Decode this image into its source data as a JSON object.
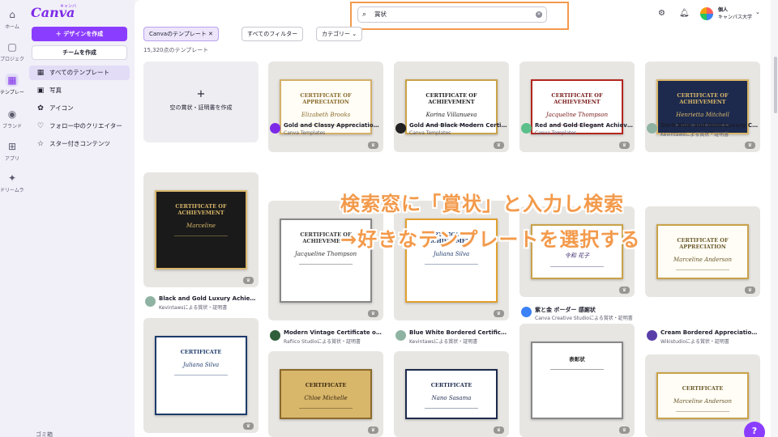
{
  "rail": [
    {
      "icon": "⌂",
      "label": "ホーム",
      "name": "home"
    },
    {
      "icon": "▢",
      "label": "プロジェクト",
      "name": "projects"
    },
    {
      "icon": "▦",
      "label": "テンプレート",
      "name": "templates",
      "active": true
    },
    {
      "icon": "◉",
      "label": "ブランド",
      "name": "brand"
    },
    {
      "icon": "⊞",
      "label": "アプリ",
      "name": "apps"
    },
    {
      "icon": "✦",
      "label": "ドリームラボ",
      "name": "dreamlab"
    }
  ],
  "sidebar": {
    "logo": "Canva",
    "logo_kana": "キャンバ",
    "create_label": "＋ デザインを作成",
    "team_label": "チームを作成",
    "items": [
      {
        "icon": "▦",
        "label": "すべてのテンプレート",
        "active": true
      },
      {
        "icon": "▣",
        "label": "写真"
      },
      {
        "icon": "✿",
        "label": "アイコン"
      },
      {
        "icon": "♡",
        "label": "フォロー中のクリエイター"
      },
      {
        "icon": "☆",
        "label": "スター付きコンテンツ"
      }
    ],
    "trash_label": "ゴミ箱"
  },
  "header": {
    "search_value": "賞状",
    "account_name": "個人",
    "account_sub": "キャンパス大学"
  },
  "filters": {
    "chip_selected": "Canvaのテンプレート ✕",
    "chip_all": "すべてのフィルター",
    "chip_category": "カテゴリー ⌄"
  },
  "result_count": "15,320点のテンプレート",
  "empty_card_label": "空の賞状・証明書を作成",
  "cards": [
    {
      "title": "Gold and Classy Appreciation Cer...",
      "author": "Canva Templates",
      "avatar_color": "#7d2ae8",
      "cert_title": "CERTIFICATE OF APPRECIATION",
      "cert_name": "Elizabeth Brooks",
      "bg": "#fffdf5",
      "fg": "#8a6a2c",
      "accent": "#d4b06a"
    },
    {
      "title": "Gold And Black Modern Certificate",
      "author": "Canva Templates",
      "avatar_color": "#222222",
      "cert_title": "CERTIFICATE OF ACHIEVEMENT",
      "cert_name": "Korina Villanueva",
      "bg": "#ffffff",
      "fg": "#222222",
      "accent": "#c9a24a"
    },
    {
      "title": "Red and Gold Elegant Achieveme...",
      "author": "Canva Templates",
      "avatar_color": "#5bbf8b",
      "cert_title": "CERTIFICATE OF ACHIEVEMENT",
      "cert_name": "Jacqueline Thompson",
      "bg": "#ffffff",
      "fg": "#7a1a1a",
      "accent": "#b3261e"
    },
    {
      "title": "Dark Blue and Gold Luxury Certifi...",
      "author": "Kevintawsによる賞状・証明書",
      "avatar_color": "#8fb3a3",
      "cert_title": "CERTIFICATE OF ACHIEVEMENT",
      "cert_name": "Henrietta Mitchell",
      "bg": "#1d2a4d",
      "fg": "#d8b66a",
      "accent": "#d8b66a"
    },
    {
      "title": "Black and Gold Luxury Achievem...",
      "author": "Kevintawsによる賞状・証明書",
      "avatar_color": "#8fb3a3",
      "cert_title": "CERTIFICATE OF ACHIEVEMENT",
      "cert_name": "Marceline",
      "bg": "#1a1a1a",
      "fg": "#d8b66a",
      "accent": "#d8b66a"
    },
    {
      "title": "Modern Vintage Certificate of Ac...",
      "author": "Rafiico Studioによる賞状・証明書",
      "avatar_color": "#2f5e3a",
      "cert_title": "CERTIFICATE OF ACHIEVEMENT",
      "cert_name": "Jacqueline Thompson",
      "bg": "#ffffff",
      "fg": "#333333",
      "accent": "#888888"
    },
    {
      "title": "Blue White Bordered Certificate ...",
      "author": "Kevintawsによる賞状・証明書",
      "avatar_color": "#8fb3a3",
      "cert_title": "CERTIFICATE OF ACHIEVEMENT",
      "cert_name": "Juliana Silva",
      "bg": "#ffffff",
      "fg": "#1d3b6b",
      "accent": "#e0a030"
    },
    {
      "title": "紫と金 ボーダー 感謝状",
      "author": "Canva Creative Studioによる賞状・証明書",
      "avatar_color": "#3b82f6",
      "cert_title": "感謝状",
      "cert_name": "令和 花子",
      "bg": "#ffffff",
      "fg": "#3d2a6b",
      "accent": "#c9a24a"
    },
    {
      "title": "Cream Bordered Appreciation Ce...",
      "author": "Wikistudioによる賞状・証明書",
      "avatar_color": "#5a3ea8",
      "cert_title": "CERTIFICATE OF APPRECIATION",
      "cert_name": "Marceline Anderson",
      "bg": "#fffdf5",
      "fg": "#6b5a2c",
      "accent": "#c9a24a"
    },
    {
      "title": "",
      "author": "",
      "avatar_color": "",
      "cert_title": "CERTIFICATE",
      "cert_name": "Juliana Silva",
      "bg": "#ffffff",
      "fg": "#1d3b6b",
      "accent": "#1d3b6b"
    },
    {
      "title": "",
      "author": "",
      "avatar_color": "",
      "cert_title": "CERTIFICATE",
      "cert_name": "Chloe Michelle",
      "bg": "#d8b66a",
      "fg": "#3a2a10",
      "accent": "#8a6a2c"
    },
    {
      "title": "",
      "author": "",
      "avatar_color": "",
      "cert_title": "CERTIFICATE",
      "cert_name": "Nano Sasama",
      "bg": "#ffffff",
      "fg": "#1d2a4d",
      "accent": "#1d2a4d"
    },
    {
      "title": "",
      "author": "",
      "avatar_color": "",
      "cert_title": "表彰状",
      "cert_name": "",
      "bg": "#ffffff",
      "fg": "#222222",
      "accent": "#888888"
    },
    {
      "title": "",
      "author": "",
      "avatar_color": "",
      "cert_title": "CERTIFICATE",
      "cert_name": "Marceline Anderson",
      "bg": "#fffdf5",
      "fg": "#6b5a2c",
      "accent": "#c9a24a"
    }
  ],
  "overlay": {
    "line1": "検索窓に「賞状」と入力し検索",
    "line2": "→好きなテンプレートを選択する"
  },
  "help_label": "?"
}
